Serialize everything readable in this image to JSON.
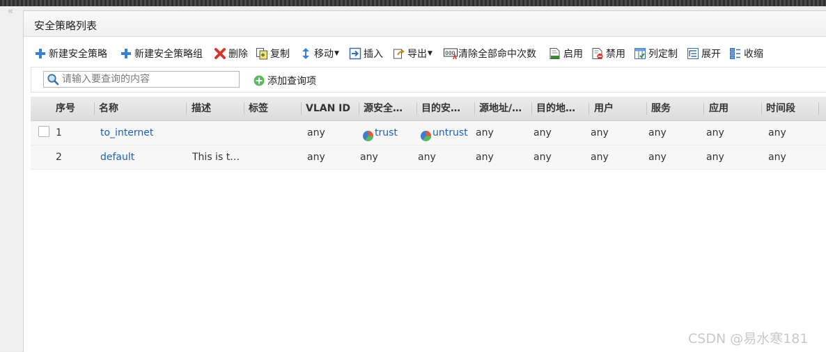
{
  "panel": {
    "title": "安全策略列表"
  },
  "toolbar": {
    "new_policy": "新建安全策略",
    "new_policy_group": "新建安全策略组",
    "delete": "删除",
    "copy": "复制",
    "move": "移动",
    "insert": "插入",
    "export": "导出",
    "clear_hits": "清除全部命中次数",
    "enable": "启用",
    "disable": "禁用",
    "customize_columns": "列定制",
    "expand": "展开",
    "collapse": "收缩"
  },
  "search": {
    "placeholder": "请输入要查询的内容",
    "value": "",
    "add_query_label": "添加查询项"
  },
  "table": {
    "columns": [
      "序号",
      "名称",
      "描述",
      "标签",
      "VLAN ID",
      "源安全…",
      "目的安…",
      "源地址/…",
      "目的地…",
      "用户",
      "服务",
      "应用",
      "时间段"
    ],
    "rows": [
      {
        "seq": "1",
        "name": "to_internet",
        "desc": "",
        "tag": "",
        "vlan": "any",
        "src_zone": "trust",
        "dst_zone": "untrust",
        "src_addr": "any",
        "dst_addr": "any",
        "user": "any",
        "service": "any",
        "app": "any",
        "time": "any"
      },
      {
        "seq": "2",
        "name": "default",
        "desc": "This is t…",
        "tag": "",
        "vlan": "any",
        "src_zone": "any",
        "dst_zone": "any",
        "src_addr": "any",
        "dst_addr": "any",
        "user": "any",
        "service": "any",
        "app": "any",
        "time": "any"
      }
    ]
  },
  "watermark": "CSDN @易水寒181",
  "colors": {
    "link": "#1d5fb8",
    "header_bg": "#e3e3e3",
    "accent_add": "#3a7fd5"
  }
}
